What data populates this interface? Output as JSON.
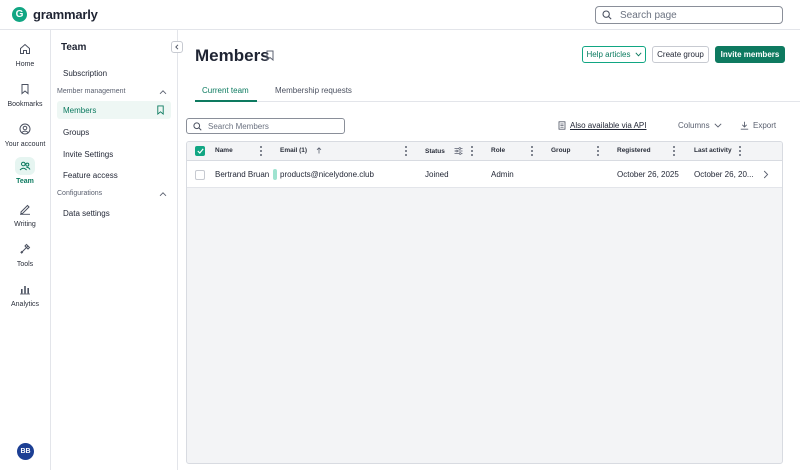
{
  "app": {
    "name": "grammarly",
    "logo_letter": "G"
  },
  "topbar": {
    "search_placeholder": "Search page"
  },
  "rail": {
    "items": [
      {
        "label": "Home",
        "icon": "home-icon"
      },
      {
        "label": "Bookmarks",
        "icon": "bookmark-icon"
      },
      {
        "label": "Your account",
        "icon": "account-icon"
      },
      {
        "label": "Team",
        "icon": "team-icon",
        "active": true
      },
      {
        "label": "Writing",
        "icon": "pen-icon"
      },
      {
        "label": "Tools",
        "icon": "tools-icon"
      },
      {
        "label": "Analytics",
        "icon": "analytics-icon"
      }
    ],
    "avatar_initials": "BB"
  },
  "sidebar": {
    "title": "Team",
    "subscription": "Subscription",
    "member_management": "Member management",
    "members": "Members",
    "groups": "Groups",
    "invite_settings": "Invite Settings",
    "feature_access": "Feature access",
    "configurations": "Configurations",
    "data_settings": "Data settings"
  },
  "header": {
    "title": "Members",
    "help_articles": "Help articles",
    "create_group": "Create group",
    "invite_members": "Invite members"
  },
  "tabs": {
    "current_team": "Current team",
    "membership_requests": "Membership requests"
  },
  "toolbar": {
    "search_placeholder": "Search Members",
    "api_link": "Also available via API",
    "columns": "Columns",
    "export": "Export"
  },
  "table": {
    "headers": {
      "name": "Name",
      "email": "Email (1)",
      "status": "Status",
      "role": "Role",
      "group": "Group",
      "registered": "Registered",
      "last_activity": "Last activity"
    },
    "rows": [
      {
        "name": "Bertrand Bruan",
        "email": "products@nicelydone.club",
        "status": "Joined",
        "role": "Admin",
        "group": "",
        "registered": "October 26, 2025",
        "last_activity": "October 26, 20..."
      }
    ]
  },
  "colors": {
    "accent": "#0e7a60",
    "accent_light": "#11a683",
    "avatar": "#1c3f94"
  }
}
